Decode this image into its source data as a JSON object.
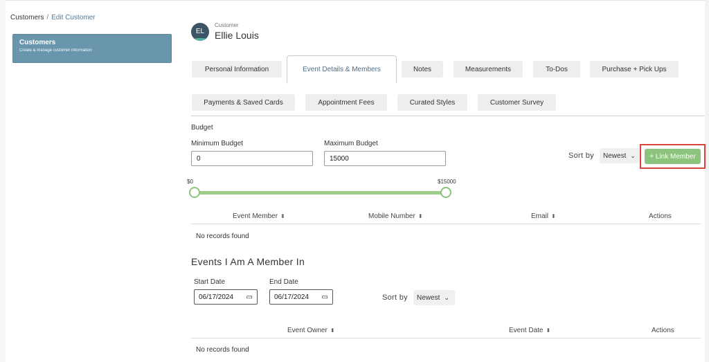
{
  "breadcrumb": {
    "root": "Customers",
    "separator": "/",
    "current": "Edit Customer"
  },
  "sidebar": {
    "title": "Customers",
    "subtitle": "Create & manage customer information"
  },
  "customer": {
    "initials": "EL",
    "label": "Customer",
    "name": "Ellie Louis"
  },
  "tabs": [
    {
      "label": "Personal Information"
    },
    {
      "label": "Event Details & Members"
    },
    {
      "label": "Notes"
    },
    {
      "label": "Measurements"
    },
    {
      "label": "To-Dos"
    },
    {
      "label": "Purchase + Pick Ups"
    },
    {
      "label": "Payments & Saved Cards"
    },
    {
      "label": "Appointment Fees"
    },
    {
      "label": "Curated Styles"
    },
    {
      "label": "Customer Survey"
    }
  ],
  "active_tab": "Event Details & Members",
  "budget": {
    "heading": "Budget",
    "min_label": "Minimum Budget",
    "min_value": "0",
    "max_label": "Maximum Budget",
    "max_value": "15000",
    "slider_min_label": "$0",
    "slider_max_label": "$15000",
    "slider_low": 0,
    "slider_high": 15000
  },
  "members_sort": {
    "label": "Sort by",
    "value": "Newest"
  },
  "link_member_button": "+  Link Member",
  "members_table": {
    "columns": [
      "Event Member",
      "Mobile Number",
      "Email",
      "Actions"
    ],
    "empty": "No records found"
  },
  "events_section": {
    "title": "Events I Am A Member In",
    "start_label": "Start Date",
    "start_value": "06/17/2024",
    "end_label": "End Date",
    "end_value": "06/17/2024",
    "sort_label": "Sort by",
    "sort_value": "Newest",
    "columns": [
      "Event Owner",
      "Event Date",
      "Actions"
    ],
    "empty": "No records found"
  },
  "icons": {
    "sort": "sort-updown-icon",
    "calendar": "calendar-icon",
    "chevron": "chevron-down-icon"
  },
  "colors": {
    "sidebar": "#6a96ad",
    "accent_green": "#8cc47e",
    "highlight_red": "#d9453b",
    "link": "#4a7ea3"
  }
}
